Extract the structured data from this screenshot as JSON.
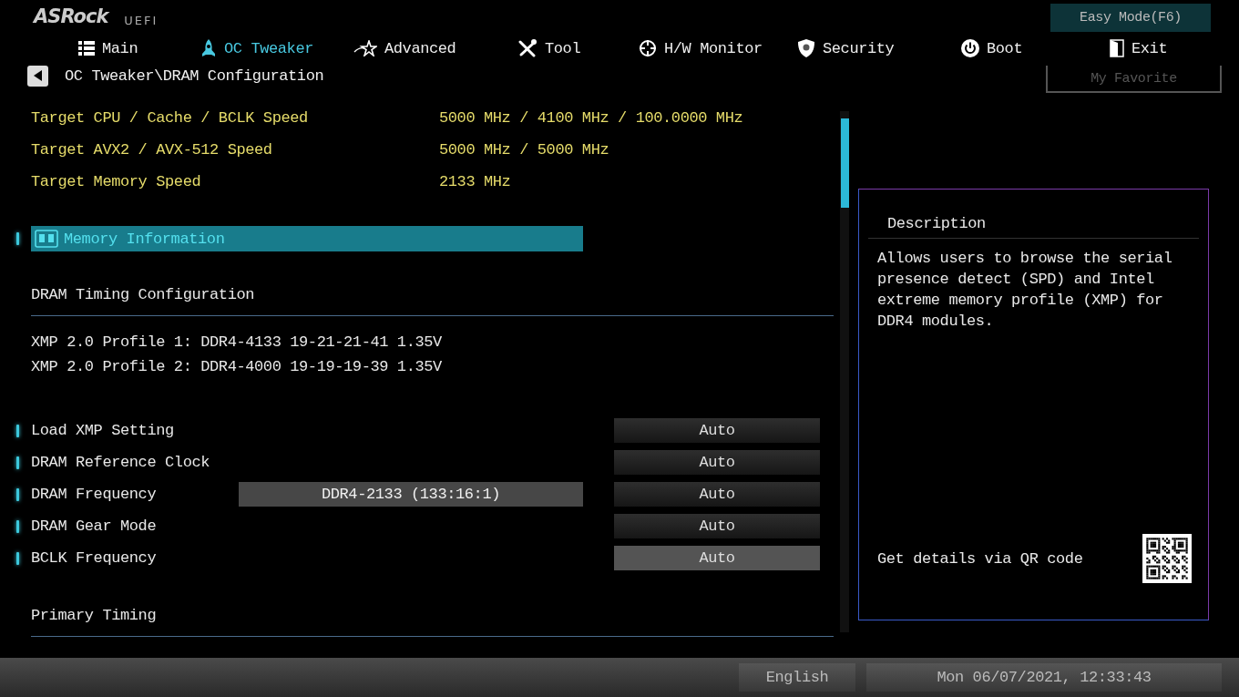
{
  "logo": {
    "brand": "ASRock",
    "sub": "UEFI"
  },
  "easy_mode_button": "Easy Mode(F6)",
  "tabs": [
    {
      "label": "Main",
      "selected": false
    },
    {
      "label": "OC Tweaker",
      "selected": true
    },
    {
      "label": "Advanced",
      "selected": false
    },
    {
      "label": "Tool",
      "selected": false
    },
    {
      "label": "H/W Monitor",
      "selected": false
    },
    {
      "label": "Security",
      "selected": false
    },
    {
      "label": "Boot",
      "selected": false
    },
    {
      "label": "Exit",
      "selected": false
    }
  ],
  "favorite_button": "My Favorite",
  "breadcrumb": "OC Tweaker\\DRAM Configuration",
  "info_rows": [
    {
      "label": "Target CPU / Cache / BCLK Speed",
      "value": "5000 MHz / 4100 MHz / 100.0000 MHz"
    },
    {
      "label": "Target AVX2 / AVX-512 Speed",
      "value": "5000 MHz / 5000 MHz"
    },
    {
      "label": "Target Memory Speed",
      "value": "2133 MHz"
    }
  ],
  "items": [
    {
      "kind": "submenu",
      "label": "Memory Information",
      "selected": true
    },
    {
      "kind": "heading",
      "label": "DRAM Timing Configuration"
    },
    {
      "kind": "text",
      "label": "XMP 2.0 Profile 1: DDR4-4133 19-21-21-41 1.35V"
    },
    {
      "kind": "text",
      "label": "XMP 2.0 Profile 2: DDR4-4000 19-19-19-39 1.35V"
    },
    {
      "kind": "setting",
      "label": "Load XMP Setting",
      "value": "Auto",
      "highlighted": false
    },
    {
      "kind": "setting",
      "label": "DRAM Reference Clock",
      "value": "Auto",
      "highlighted": false
    },
    {
      "kind": "setting",
      "label": "DRAM Frequency",
      "extra_value": "DDR4-2133 (133:16:1)",
      "value": "Auto",
      "highlighted": false
    },
    {
      "kind": "setting",
      "label": "DRAM Gear Mode",
      "value": "Auto",
      "highlighted": false
    },
    {
      "kind": "setting",
      "label": "BCLK Frequency",
      "value": "Auto",
      "highlighted": true
    },
    {
      "kind": "heading",
      "label": "Primary Timing"
    }
  ],
  "description": {
    "title": "Description",
    "text": "Allows users to browse the serial presence detect (SPD) and Intel extreme memory profile (XMP) for DDR4 modules.",
    "qr_caption": "Get details via QR code"
  },
  "status_bar": {
    "language": "English",
    "datetime": "Mon 06/07/2021, 12:33:43"
  }
}
